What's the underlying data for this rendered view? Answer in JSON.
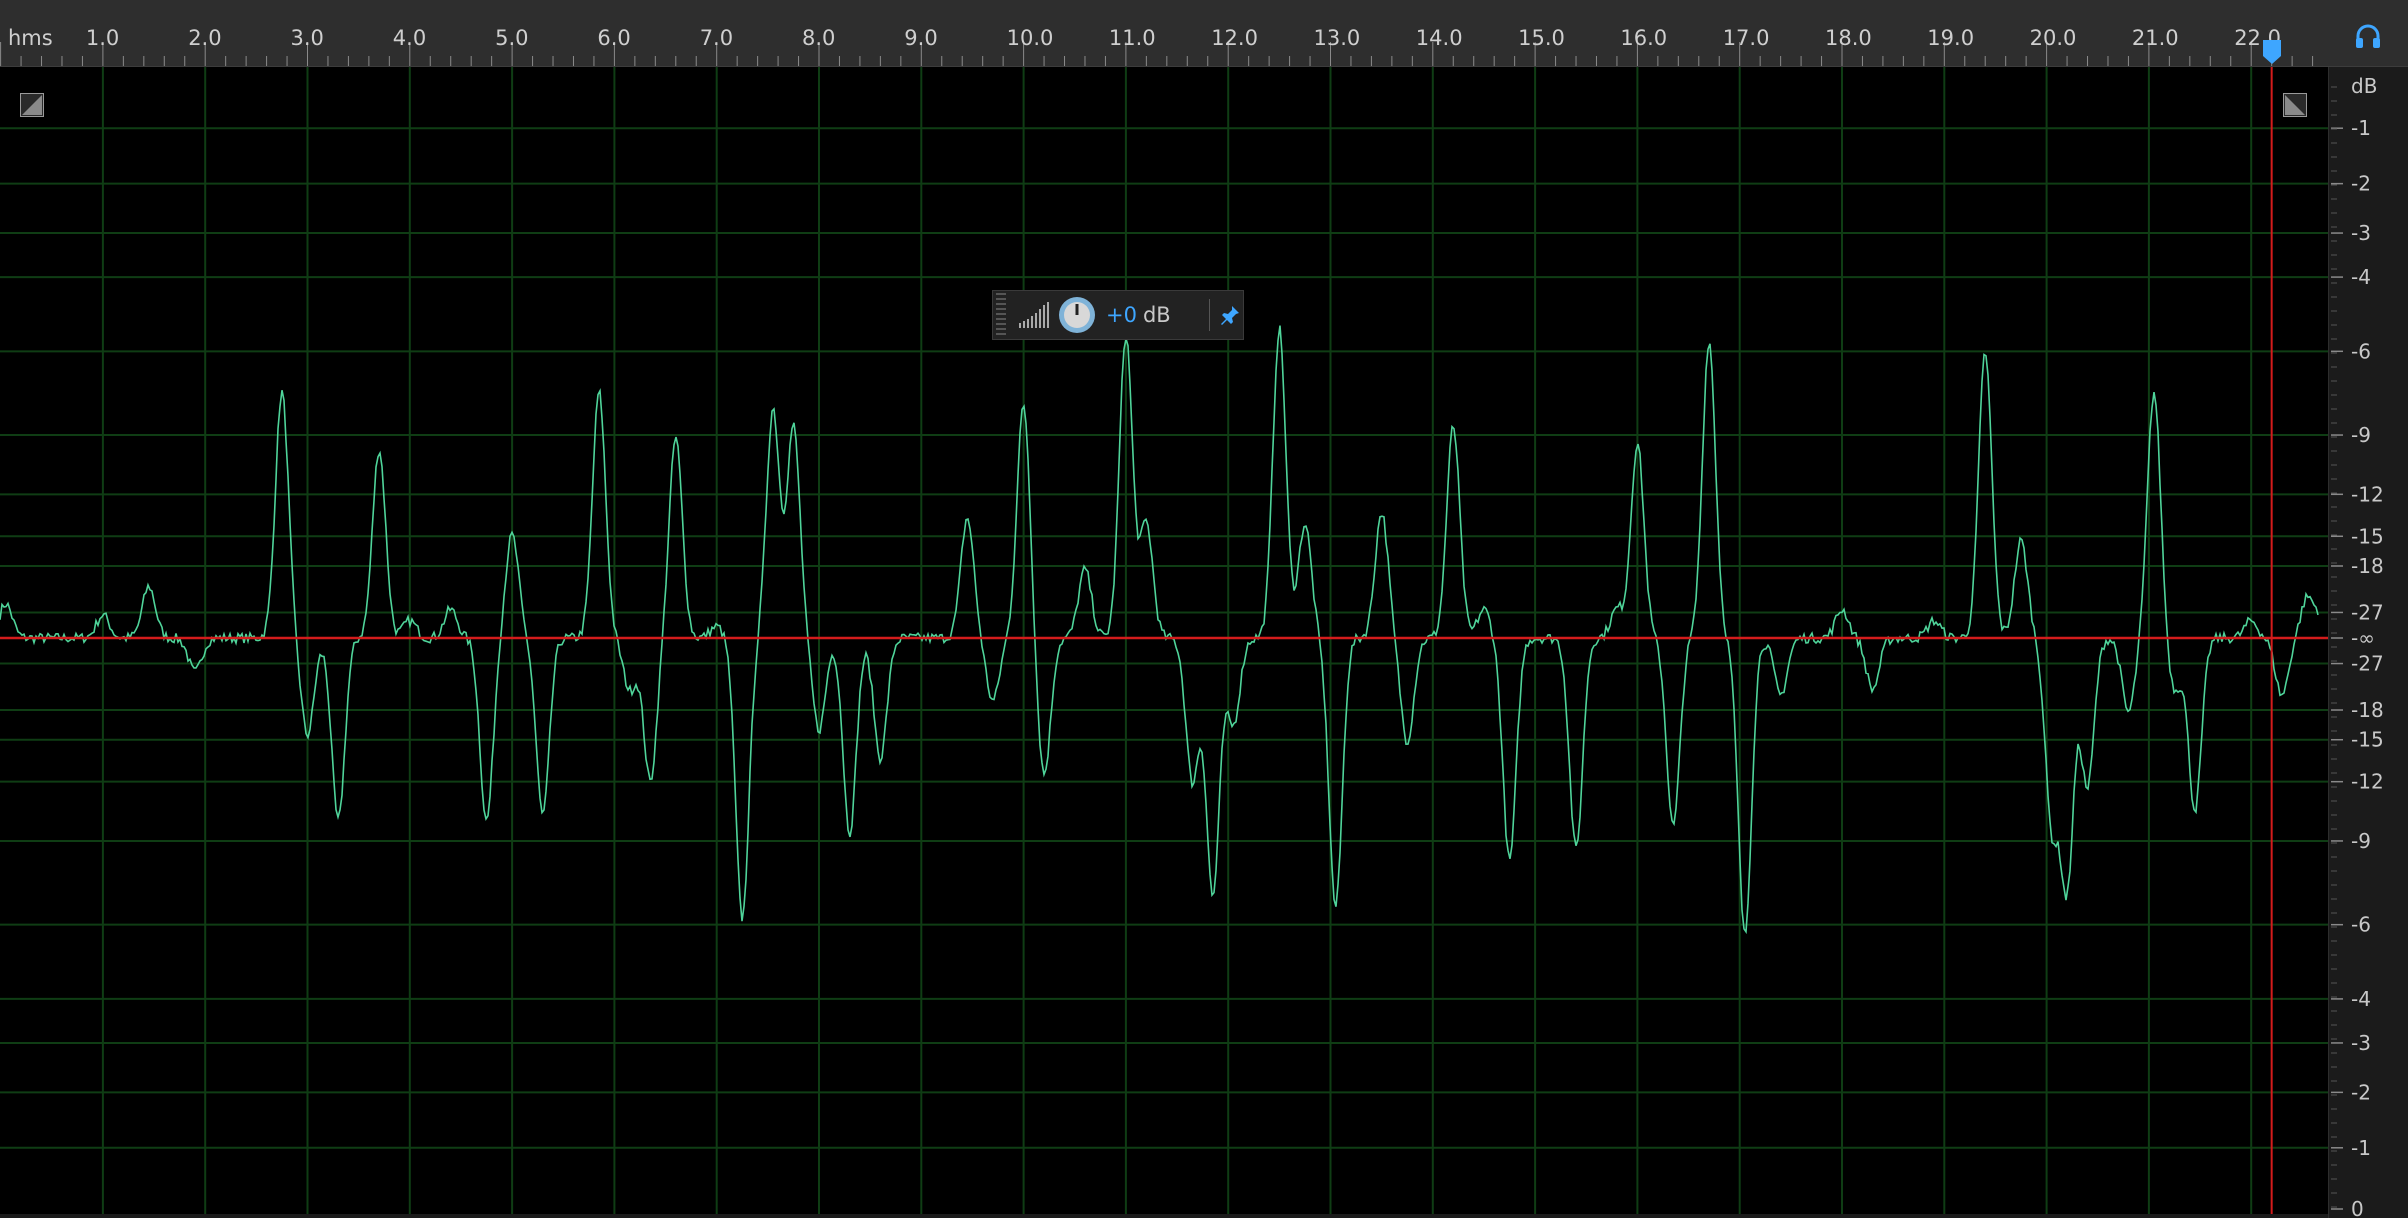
{
  "ruler": {
    "unit_label": "hms",
    "time_labels": [
      "1.0",
      "2.0",
      "3.0",
      "4.0",
      "5.0",
      "6.0",
      "7.0",
      "8.0",
      "9.0",
      "10.0",
      "11.0",
      "12.0",
      "13.0",
      "14.0",
      "15.0",
      "16.0",
      "17.0",
      "18.0",
      "19.0",
      "20.0",
      "21.0",
      "22.0"
    ]
  },
  "amplitude_scale": {
    "unit": "dB",
    "top_labels": [
      "-1",
      "-2",
      "-3",
      "-4",
      "-6",
      "-9",
      "-12",
      "-15",
      "-18",
      "-27"
    ],
    "center_label": "-∞",
    "bottom_labels": [
      "-27",
      "-18",
      "-15",
      "-12",
      "-9",
      "-6",
      "-4",
      "-3",
      "-2",
      "-1",
      "0"
    ]
  },
  "hud": {
    "gain_value": "+0",
    "gain_unit": "dB"
  },
  "playhead": {
    "time": 22.2
  },
  "colors": {
    "waveform": "#4fd49a",
    "grid": "#0f3d14",
    "center_line": "#d41c1c",
    "playhead": "#d41c1c",
    "accent": "#3ea6ff",
    "background": "#000000"
  },
  "waveform_peaks": [
    {
      "t": 0.05,
      "a": 0.06
    },
    {
      "t": 1.0,
      "a": 0.04
    },
    {
      "t": 1.45,
      "a": 0.09
    },
    {
      "t": 1.9,
      "a": -0.06
    },
    {
      "t": 2.75,
      "a": 0.43
    },
    {
      "t": 3.0,
      "a": -0.17
    },
    {
      "t": 3.3,
      "a": -0.32
    },
    {
      "t": 3.7,
      "a": 0.33
    },
    {
      "t": 4.0,
      "a": 0.03
    },
    {
      "t": 4.4,
      "a": 0.05
    },
    {
      "t": 4.75,
      "a": -0.32
    },
    {
      "t": 5.0,
      "a": 0.18
    },
    {
      "t": 5.3,
      "a": -0.31
    },
    {
      "t": 5.85,
      "a": 0.43
    },
    {
      "t": 6.15,
      "a": -0.09
    },
    {
      "t": 6.35,
      "a": -0.25
    },
    {
      "t": 6.6,
      "a": 0.35
    },
    {
      "t": 7.0,
      "a": 0.02
    },
    {
      "t": 7.25,
      "a": -0.49
    },
    {
      "t": 7.55,
      "a": 0.4
    },
    {
      "t": 7.75,
      "a": 0.37
    },
    {
      "t": 8.0,
      "a": -0.16
    },
    {
      "t": 8.3,
      "a": -0.34
    },
    {
      "t": 8.6,
      "a": -0.21
    },
    {
      "t": 9.0,
      "a": 0.0
    },
    {
      "t": 9.45,
      "a": 0.21
    },
    {
      "t": 9.7,
      "a": -0.11
    },
    {
      "t": 10.0,
      "a": 0.41
    },
    {
      "t": 10.2,
      "a": -0.24
    },
    {
      "t": 10.6,
      "a": 0.12
    },
    {
      "t": 11.0,
      "a": 0.53
    },
    {
      "t": 11.2,
      "a": 0.2
    },
    {
      "t": 11.65,
      "a": -0.25
    },
    {
      "t": 11.85,
      "a": -0.45
    },
    {
      "t": 12.05,
      "a": -0.15
    },
    {
      "t": 12.5,
      "a": 0.54
    },
    {
      "t": 12.75,
      "a": 0.2
    },
    {
      "t": 13.05,
      "a": -0.47
    },
    {
      "t": 13.5,
      "a": 0.22
    },
    {
      "t": 13.75,
      "a": -0.18
    },
    {
      "t": 14.2,
      "a": 0.37
    },
    {
      "t": 14.5,
      "a": 0.05
    },
    {
      "t": 14.75,
      "a": -0.39
    },
    {
      "t": 15.4,
      "a": -0.37
    },
    {
      "t": 15.8,
      "a": 0.05
    },
    {
      "t": 16.0,
      "a": 0.34
    },
    {
      "t": 16.35,
      "a": -0.33
    },
    {
      "t": 16.7,
      "a": 0.52
    },
    {
      "t": 17.05,
      "a": -0.52
    },
    {
      "t": 17.4,
      "a": -0.1
    },
    {
      "t": 18.0,
      "a": 0.05
    },
    {
      "t": 18.3,
      "a": -0.09
    },
    {
      "t": 18.9,
      "a": 0.03
    },
    {
      "t": 19.4,
      "a": 0.5
    },
    {
      "t": 19.75,
      "a": 0.17
    },
    {
      "t": 20.05,
      "a": -0.32
    },
    {
      "t": 20.2,
      "a": -0.43
    },
    {
      "t": 20.4,
      "a": -0.26
    },
    {
      "t": 20.8,
      "a": -0.13
    },
    {
      "t": 21.05,
      "a": 0.43
    },
    {
      "t": 21.25,
      "a": -0.09
    },
    {
      "t": 21.45,
      "a": -0.3
    },
    {
      "t": 22.0,
      "a": 0.03
    },
    {
      "t": 22.3,
      "a": -0.1
    },
    {
      "t": 22.55,
      "a": 0.07
    },
    {
      "t": 22.7,
      "a": 0.04
    }
  ]
}
